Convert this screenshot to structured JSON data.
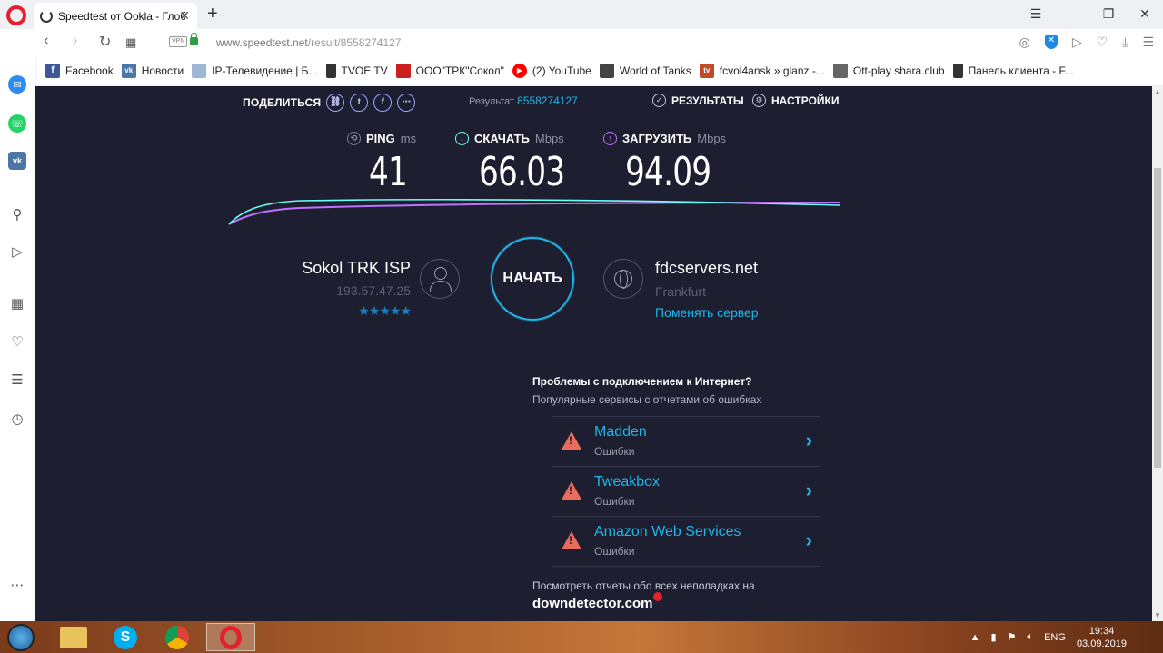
{
  "browser": {
    "tab_title": "Speedtest от Ookla - Глоб",
    "url_host": "www.speedtest.net",
    "url_path": "/result/8558274127",
    "vpn_badge": "VPN"
  },
  "bookmarks": [
    {
      "label": "Facebook",
      "color": "#3b5998",
      "glyph": "f"
    },
    {
      "label": "Новости",
      "color": "#4a76a8",
      "glyph": "vk"
    },
    {
      "label": "IP-Телевидение | Б...",
      "color": "#9fb7d6",
      "glyph": ""
    },
    {
      "label": "TVOE TV",
      "color": "#333333",
      "glyph": ""
    },
    {
      "label": "ООО\"ТРК\"Сокол\"",
      "color": "#cc1f1f",
      "glyph": ""
    },
    {
      "label": "(2) YouTube",
      "color": "#ff0000",
      "glyph": "▶"
    },
    {
      "label": "World of Tanks",
      "color": "#444444",
      "glyph": ""
    },
    {
      "label": "fcvol4ansk » glanz -...",
      "color": "#c24a2a",
      "glyph": "tv"
    },
    {
      "label": "Ott-play shara.club",
      "color": "#666666",
      "glyph": ""
    },
    {
      "label": "Панель клиента - F...",
      "color": "#333333",
      "glyph": ""
    }
  ],
  "speedtest": {
    "share_label": "ПОДЕЛИТЬСЯ",
    "result_label": "Результат",
    "result_id": "8558274127",
    "results_btn": "РЕЗУЛЬТАТЫ",
    "settings_btn": "НАСТРОЙКИ",
    "ping": {
      "label": "PING",
      "unit": "ms",
      "value": "41"
    },
    "download": {
      "label": "СКАЧАТЬ",
      "unit": "Mbps",
      "value": "66.03"
    },
    "upload": {
      "label": "ЗАГРУЗИТЬ",
      "unit": "Mbps",
      "value": "94.09"
    },
    "isp_name": "Sokol TRK ISP",
    "isp_ip": "193.57.47.25",
    "isp_stars": "★★★★★",
    "go_label": "НАЧАТЬ",
    "server_name": "fdcservers.net",
    "server_city": "Frankfurt",
    "change_server": "Поменять сервер",
    "colors": {
      "download": "#6afff3",
      "upload": "#bf71ff",
      "accent": "#1fb6e8",
      "background": "#1d1f30"
    }
  },
  "issues": {
    "title": "Проблемы с подключением к Интернет?",
    "subtitle": "Популярные сервисы с отчетами об ошибках",
    "items": [
      {
        "name": "Madden",
        "status": "Ошибки"
      },
      {
        "name": "Tweakbox",
        "status": "Ошибки"
      },
      {
        "name": "Amazon Web Services",
        "status": "Ошибки"
      }
    ],
    "footer_text": "Посмотреть отчеты обо всех неполадках на",
    "footer_brand": "downdetector.com"
  },
  "taskbar": {
    "lang": "ENG",
    "time": "19:34",
    "date": "03.09.2019"
  }
}
